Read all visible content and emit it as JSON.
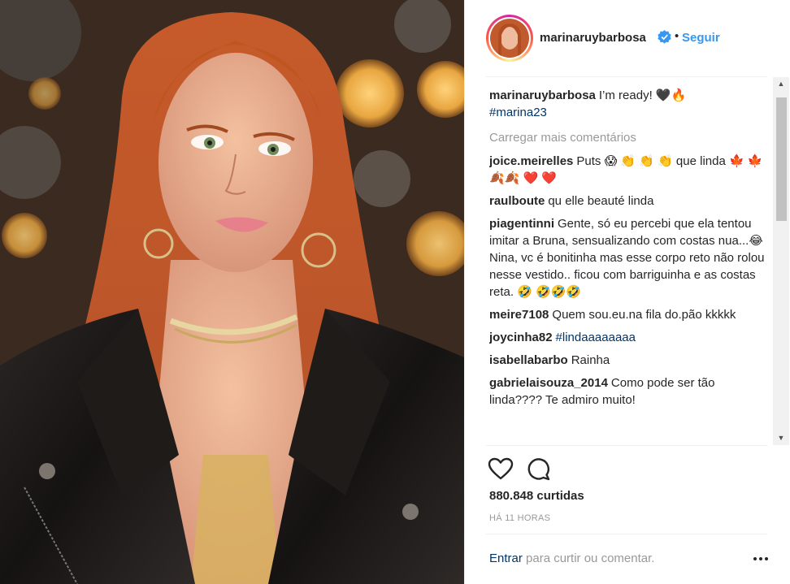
{
  "post": {
    "username": "marinaruybarbosa",
    "separator": "•",
    "follow_label": "Seguir",
    "caption": {
      "username": "marinaruybarbosa",
      "text": "I’m ready! 🖤🔥",
      "hashtag": "#marina23"
    },
    "load_more": "Carregar mais comentários",
    "comments": [
      {
        "user": "joice.meirelles",
        "text": "Puts 😱 👏 👏 👏 que linda 🍁 🍁 🍂🍂 ❤️ ❤️"
      },
      {
        "user": "raulboute",
        "text": "qu elle beauté linda"
      },
      {
        "user": "piagentinni",
        "text": "Gente, só eu percebi que ela tentou imitar a Bruna, sensualizando com costas nua...😂 Nina, vc é bonitinha mas esse corpo reto não rolou nesse vestido.. ficou com barriguinha e as costas reta. 🤣 🤣🤣🤣"
      },
      {
        "user": "meire7108",
        "text": "Quem sou.eu.na fila do.pão kkkkk"
      },
      {
        "user": "joycinha82",
        "text": "",
        "hashtag": "#lindaaaaaaaa"
      },
      {
        "user": "isabellabarbo",
        "text": "Rainha"
      },
      {
        "user": "gabrielaisouza_2014",
        "text": "Como pode ser tão linda???? Te admiro muito!"
      }
    ],
    "likes": "880.848 curtidas",
    "time": "HÁ 11 HORAS",
    "login_link": "Entrar",
    "login_text": " para curtir ou comentar."
  },
  "icons": {
    "verified": "verified-badge-icon",
    "like": "heart-outline-icon",
    "comment": "speech-bubble-icon",
    "more": "ellipsis-icon",
    "scroll_up": "▲",
    "scroll_down": "▼"
  },
  "colors": {
    "link_blue": "#3897f0",
    "hashtag": "#003569",
    "muted": "#999999",
    "text": "#262626"
  }
}
